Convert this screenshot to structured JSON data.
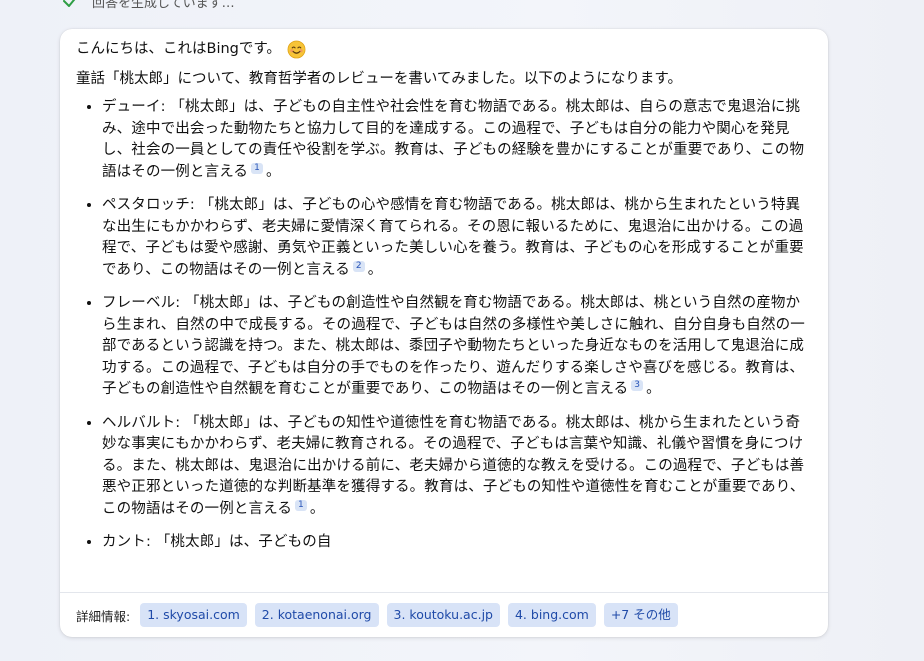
{
  "status": {
    "text": "回答を生成しています…"
  },
  "message": {
    "greeting": "こんにちは、これはBingです。",
    "intro": "童話「桃太郎」について、教育哲学者のレビューを書いてみました。以下のようになります。",
    "items": [
      {
        "text": "デューイ: 「桃太郎」は、子どもの自主性や社会性を育む物語である。桃太郎は、自らの意志で鬼退治に挑み、途中で出会った動物たちと協力して目的を達成する。この過程で、子どもは自分の能力や関心を発見し、社会の一員としての責任や役割を学ぶ。教育は、子どもの経験を豊かにすることが重要であり、この物語はその一例と言える",
        "cite": "1"
      },
      {
        "text": "ペスタロッチ: 「桃太郎」は、子どもの心や感情を育む物語である。桃太郎は、桃から生まれたという特異な出生にもかかわらず、老夫婦に愛情深く育てられる。その恩に報いるために、鬼退治に出かける。この過程で、子どもは愛や感謝、勇気や正義といった美しい心を養う。教育は、子どもの心を形成することが重要であり、この物語はその一例と言える",
        "cite": "2"
      },
      {
        "text": "フレーベル: 「桃太郎」は、子どもの創造性や自然観を育む物語である。桃太郎は、桃という自然の産物から生まれ、自然の中で成長する。その過程で、子どもは自然の多様性や美しさに触れ、自分自身も自然の一部であるという認識を持つ。また、桃太郎は、黍団子や動物たちといった身近なものを活用して鬼退治に成功する。この過程で、子どもは自分の手でものを作ったり、遊んだりする楽しさや喜びを感じる。教育は、子どもの創造性や自然観を育むことが重要であり、この物語はその一例と言える",
        "cite": "3"
      },
      {
        "text": "ヘルバルト: 「桃太郎」は、子どもの知性や道徳性を育む物語である。桃太郎は、桃から生まれたという奇妙な事実にもかかわらず、老夫婦に教育される。その過程で、子どもは言葉や知識、礼儀や習慣を身につける。また、桃太郎は、鬼退治に出かける前に、老夫婦から道徳的な教えを受ける。この過程で、子どもは善悪や正邪といった道徳的な判断基準を獲得する。教育は、子どもの知性や道徳性を育むことが重要であり、この物語はその一例と言える",
        "cite": "1"
      },
      {
        "text": "カント: 「桃太郎」は、子どもの自",
        "cite": ""
      }
    ],
    "period": "。"
  },
  "footer": {
    "label": "詳細情報:",
    "sources": [
      "1. skyosai.com",
      "2. kotaenonai.org",
      "3. koutoku.ac.jp",
      "4. bing.com",
      "+7 その他"
    ]
  },
  "colors": {
    "accent": "#1f4aa8",
    "chip_bg": "#d8e3f7",
    "check": "#2e9e44"
  },
  "icons": {
    "status": "check-icon",
    "greeting": "smiling-face-emoji"
  }
}
